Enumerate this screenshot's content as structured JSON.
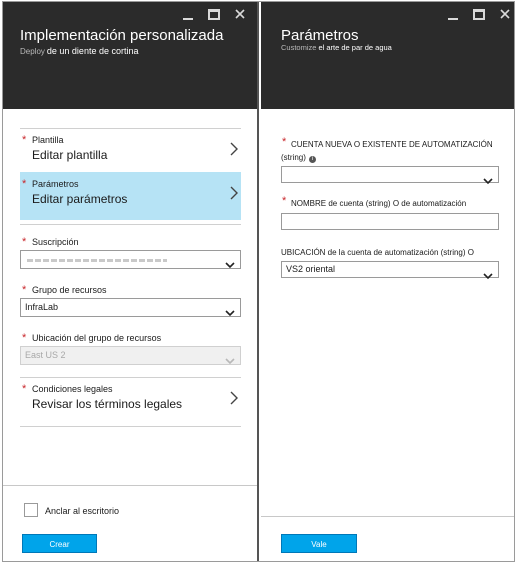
{
  "left_blade": {
    "title": "Implementación personalizada",
    "subtitle_prefix": "Deploy",
    "subtitle": "de un diente de cortina",
    "nav_items": [
      {
        "label": "Plantilla",
        "value": "Editar plantilla"
      },
      {
        "label": "Parámetros",
        "value": "Editar parámetros"
      },
      {
        "label": "Condiciones legales",
        "value": "Revisar los términos legales"
      }
    ],
    "subscription": {
      "label": "Suscripción",
      "value": ""
    },
    "resource_group": {
      "label": "Grupo de recursos",
      "value": "InfraLab"
    },
    "resource_group_location": {
      "label": "Ubicación del grupo de recursos",
      "value": "East US 2"
    },
    "pin_label": "Anclar al escritorio",
    "create_button": "Crear"
  },
  "right_blade": {
    "title": "Parámetros",
    "subtitle_prefix": "Customize",
    "subtitle": "el arte de par de agua",
    "fields": [
      {
        "label": "CUENTA NUEVA O EXISTENTE DE AUTOMATIZACIÓN (string)",
        "value": ""
      },
      {
        "label": "NOMBRE de cuenta (string) O de automatización",
        "value": ""
      },
      {
        "label": "UBICACIÓN de la cuenta de automatización (string) O",
        "value": "VS2 oriental"
      }
    ],
    "ok_button": "Vale"
  },
  "colors": {
    "header_bg": "#2b2b2b",
    "selected_item": "#b6e3f5",
    "required_star": "#c8262a",
    "button_blue": "#00a4ea"
  },
  "icons": [
    "minimize-icon",
    "maximize-icon",
    "close-icon",
    "chevron-right-icon",
    "chevron-down-icon",
    "info-icon"
  ]
}
